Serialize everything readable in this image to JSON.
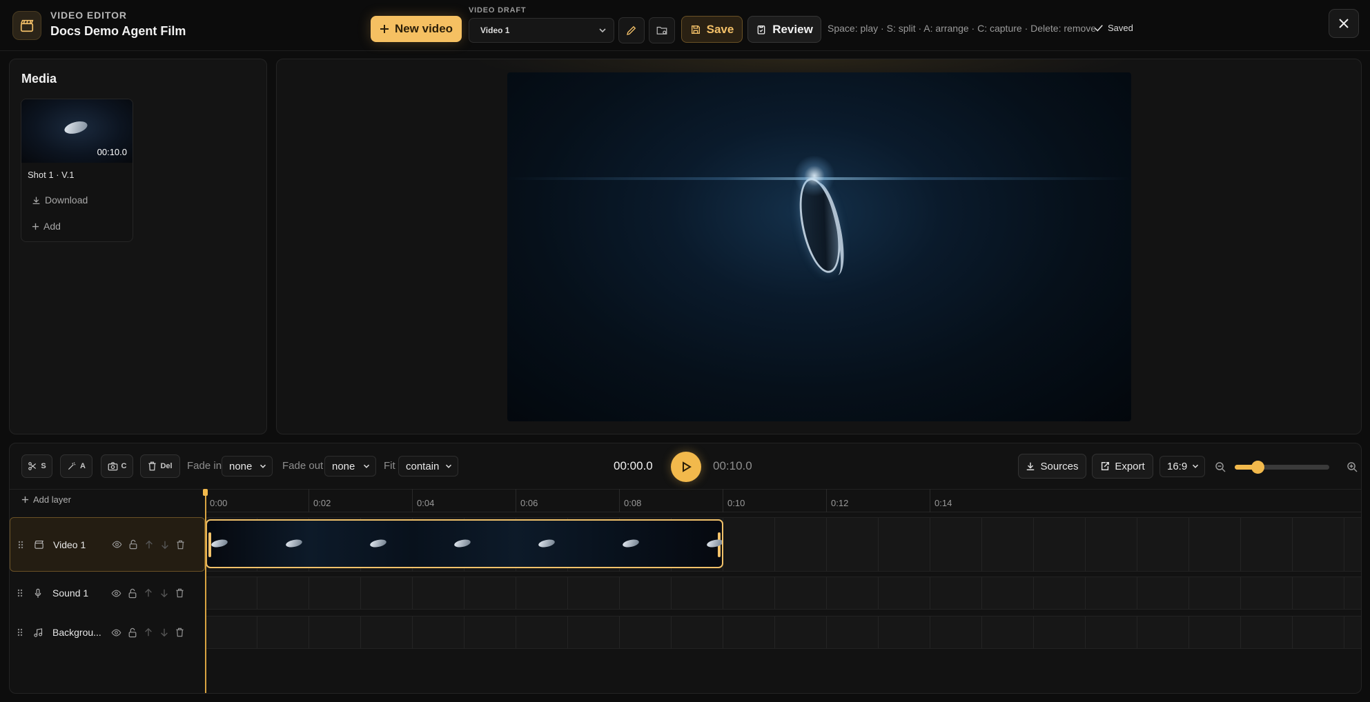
{
  "header": {
    "kicker": "VIDEO EDITOR",
    "title": "Docs Demo Agent Film",
    "new_video_label": "New video",
    "draft_label": "VIDEO DRAFT",
    "draft_value": "Video 1",
    "save_label": "Save",
    "review_label": "Review",
    "shortcuts": "Space: play · S: split · A: arrange · C: capture · Delete: remove",
    "saved_status": "Saved",
    "accent_color": "#f5c062"
  },
  "media": {
    "title": "Media",
    "items": [
      {
        "name": "Shot 1 · V.1",
        "duration": "00:10.0",
        "download_label": "Download",
        "add_label": "Add"
      }
    ]
  },
  "timeline": {
    "tools": [
      {
        "label": "S",
        "icon": "scissors-icon"
      },
      {
        "label": "A",
        "icon": "magic-wand-icon"
      },
      {
        "label": "C",
        "icon": "camera-icon"
      },
      {
        "label": "Del",
        "icon": "trash-icon"
      }
    ],
    "fade_in_label": "Fade in",
    "fade_in_value": "none",
    "fade_out_label": "Fade out",
    "fade_out_value": "none",
    "fit_label": "Fit",
    "fit_value": "contain",
    "current_time": "00:00.0",
    "total_time": "00:10.0",
    "sources_label": "Sources",
    "export_label": "Export",
    "aspect_ratio": "16:9",
    "zoom_level": 0.24,
    "add_layer_label": "Add layer",
    "ruler_labels": [
      "0:00",
      "0:02",
      "0:04",
      "0:06",
      "0:08",
      "0:10",
      "0:12",
      "0:14"
    ],
    "tracks": [
      {
        "name": "Video 1",
        "icon": "film-icon"
      },
      {
        "name": "Sound 1",
        "icon": "microphone-icon"
      },
      {
        "name": "Backgrou...",
        "icon": "music-icon"
      }
    ]
  }
}
